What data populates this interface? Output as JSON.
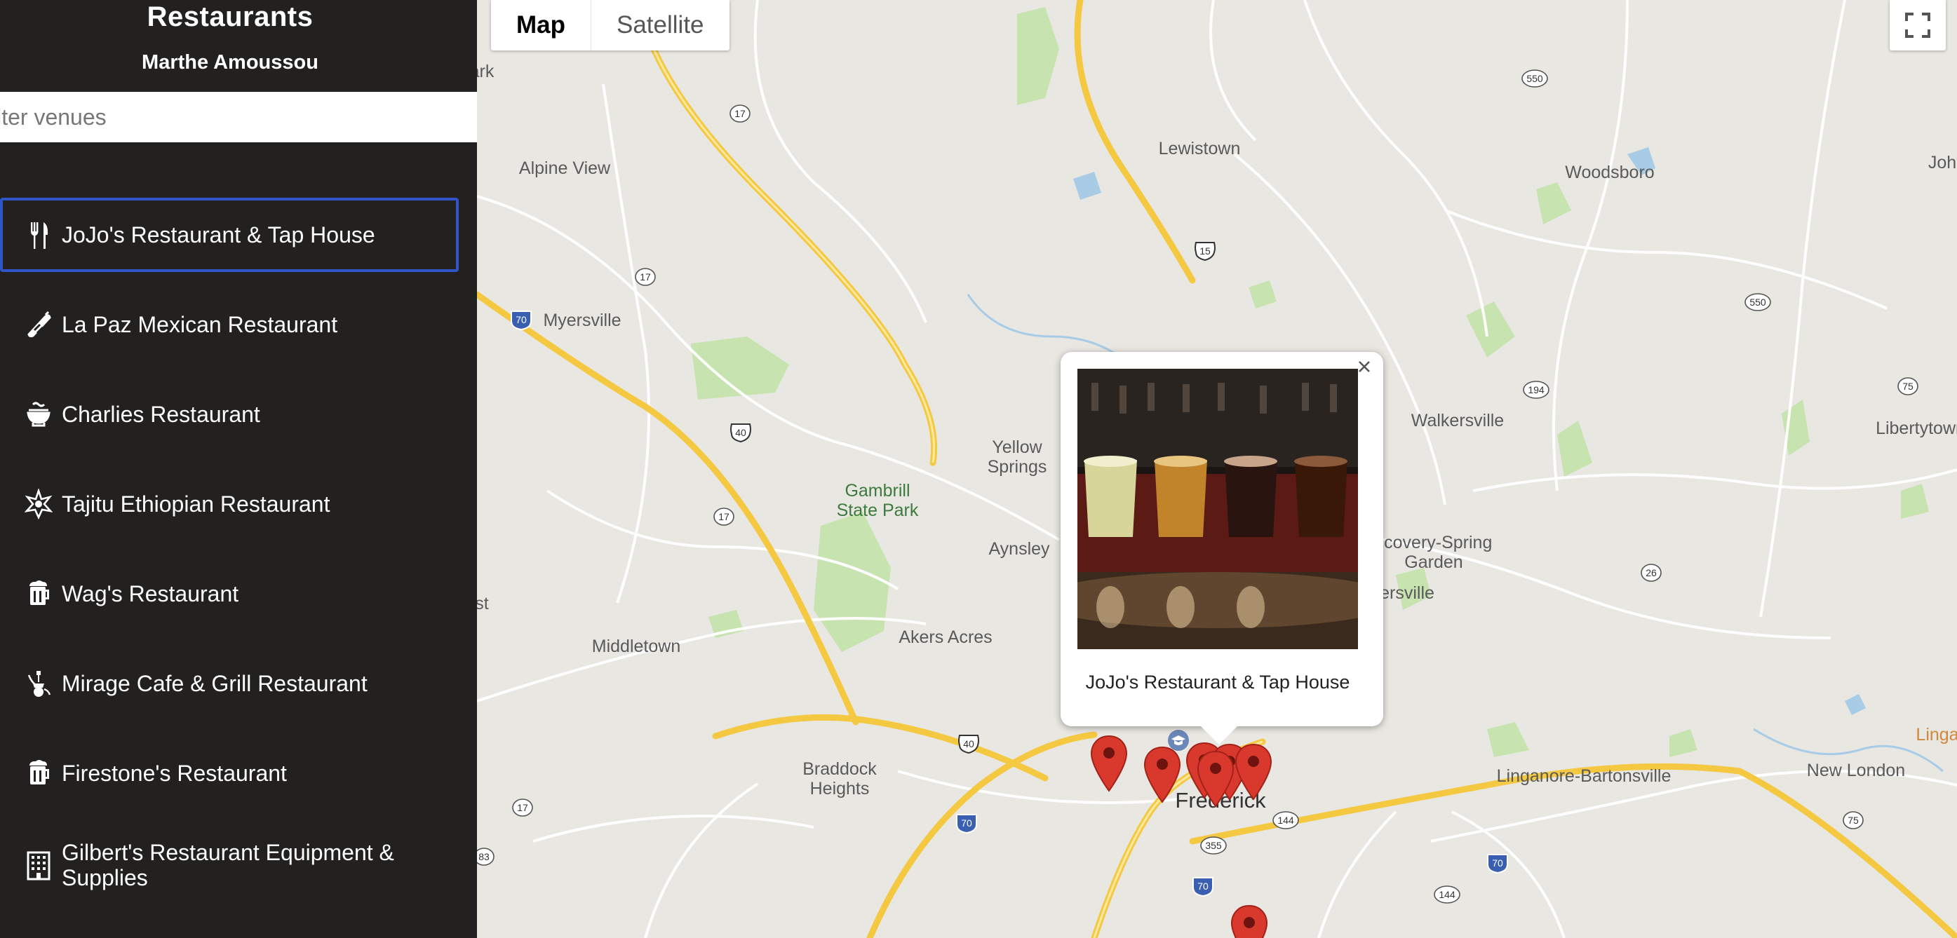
{
  "sidebar": {
    "title": "Restaurants",
    "author": "Marthe Amoussou",
    "filter_placeholder": "ilter venues",
    "venues": [
      {
        "label": "JoJo's Restaurant & Tap House",
        "icon": "fork-knife-icon",
        "active": true
      },
      {
        "label": "La Paz Mexican Restaurant",
        "icon": "burrito-icon"
      },
      {
        "label": "Charlies Restaurant",
        "icon": "noodle-bowl-icon"
      },
      {
        "label": "Tajitu Ethiopian Restaurant",
        "icon": "star-burst-icon"
      },
      {
        "label": "Wag's Restaurant",
        "icon": "beer-mug-icon"
      },
      {
        "label": "Mirage Cafe & Grill Restaurant",
        "icon": "hookah-icon"
      },
      {
        "label": "Firestone's Restaurant",
        "icon": "beer-mug-icon"
      },
      {
        "label": "Gilbert's Restaurant Equipment & Supplies",
        "icon": "building-icon"
      }
    ]
  },
  "map": {
    "type_buttons": {
      "map": "Map",
      "satellite": "Satellite"
    },
    "labels": {
      "ark": "ark",
      "alpine_view": "Alpine View",
      "lewistown": "Lewistown",
      "woodsboro": "Woodsboro",
      "john": "John",
      "myersville": "Myersville",
      "yellow_springs": "Yellow\nSprings",
      "gambrill": "Gambrill\nState Park",
      "walkersville": "Walkersville",
      "libertytown": "Libertytown",
      "aynsley": "Aynsley",
      "discovery": "scovery-Spring\nGarden",
      "ersville": "ersville",
      "st": "st",
      "middletown": "Middletown",
      "akers_acres": "Akers Acres",
      "braddock": "Braddock\nHeights",
      "frederick": "Frederick",
      "linganore": "Linganore-Bartonsville",
      "new_london": "New London",
      "linga": "Linga"
    },
    "shields": {
      "r550a": "550",
      "r17a": "17",
      "r17b": "17",
      "r17c": "17",
      "r17d": "17",
      "i70a": "70",
      "r15": "15",
      "r550b": "550",
      "r40a": "40",
      "r194": "194",
      "r75a": "75",
      "r26": "26",
      "r40b": "40",
      "r144a": "144",
      "r355": "355",
      "i70b": "70",
      "i70c": "70",
      "i70d": "70",
      "r144b": "144",
      "r75b": "75",
      "r83": "83"
    }
  },
  "infowindow": {
    "caption": "JoJo's Restaurant & Tap House"
  },
  "colors": {
    "sidebar_bg": "#222120",
    "active_border": "#2f55c8",
    "pin": "#d9382c",
    "highway": "#f5c842",
    "park": "#c7e3b0"
  }
}
